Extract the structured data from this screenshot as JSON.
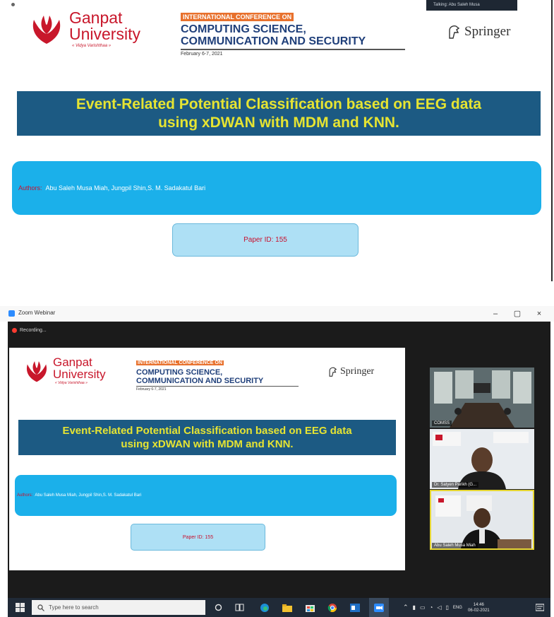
{
  "speaker_tip": "Talking: Abu Saleh Musa",
  "slide": {
    "university_line1": "Ganpat",
    "university_line2": "University",
    "university_tagline": "« Vidya Varishthaa »",
    "conf_intl": "INTERNATIONAL CONFERENCE ON",
    "conf_line1": "COMPUTING SCIENCE,",
    "conf_line2": "COMMUNICATION AND SECURITY",
    "conf_date": "February 6-7, 2021",
    "publisher": "Springer",
    "title_line1": "Event-Related Potential Classification based on EEG data",
    "title_line2": "using xDWAN with MDM and KNN.",
    "authors_label": "Authors:",
    "authors_names": "Abu Saleh Musa Miah, Jungpil Shin,S. M. Sadakatul Bari",
    "paper_id": "Paper ID: 155"
  },
  "zoom": {
    "window_title": "Zoom Webinar",
    "recording_label": "Recording...",
    "minimize": "–",
    "maximize": "▢",
    "close": "×",
    "participants": [
      {
        "name": "COMSS"
      },
      {
        "name": "Dr. Satyen Parikh (G..."
      },
      {
        "name": "Abu Saleh Musa Miah"
      }
    ]
  },
  "taskbar": {
    "search_placeholder": "Type here to search",
    "language": "ENG",
    "time": "14:46",
    "date": "06-02-2021"
  },
  "colors": {
    "title_bg": "#1c5a83",
    "title_text": "#e6e432",
    "authors_bg": "#1bb0ea",
    "paper_bg": "#aee0f5",
    "brand_red": "#c8172b",
    "conf_orange": "#e8712d",
    "conf_navy": "#1f3f7a",
    "taskbar_bg": "#202a37",
    "active_speaker_border": "#e6d634"
  }
}
